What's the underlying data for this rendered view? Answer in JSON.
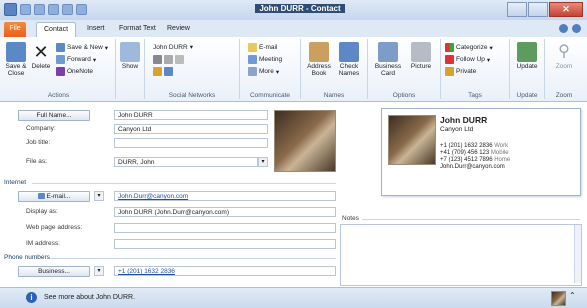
{
  "window": {
    "title_name": "John DURR",
    "title_suffix": "- Contact"
  },
  "tabs": [
    "File",
    "Contact",
    "Insert",
    "Format Text",
    "Review"
  ],
  "ribbon": {
    "actions": {
      "save_close": "Save & Close",
      "delete": "Delete",
      "save_new": "Save & New",
      "forward": "Forward",
      "onenote": "OneNote",
      "label": "Actions"
    },
    "show": {
      "label": "Show"
    },
    "social": {
      "contact": "John DURR",
      "label": "Social Networks"
    },
    "communicate": {
      "email": "E-mail",
      "meeting": "Meeting",
      "more": "More",
      "label": "Communicate"
    },
    "names": {
      "address_book": "Address Book",
      "check_names": "Check Names",
      "label": "Names"
    },
    "options": {
      "business_card": "Business Card",
      "picture": "Picture",
      "label": "Options"
    },
    "tags": {
      "categorize": "Categorize",
      "follow_up": "Follow Up",
      "private": "Private",
      "label": "Tags"
    },
    "update": {
      "update": "Update",
      "label": "Update"
    },
    "zoom": {
      "zoom": "Zoom",
      "label": "Zoom"
    }
  },
  "form": {
    "full_name_btn": "Full Name...",
    "full_name": "John DURR",
    "company_label": "Company:",
    "company": "Canyon Ltd",
    "job_title_label": "Job title:",
    "job_title": "",
    "file_as_label": "File as:",
    "file_as": "DURR, John",
    "internet_label": "Internet",
    "email_btn": "E-mail...",
    "email": "John.Durr@canyon.com",
    "display_as_label": "Display as:",
    "display_as": "John DURR (John.Durr@canyon.com)",
    "web_label": "Web page address:",
    "web": "",
    "im_label": "IM address:",
    "im": "",
    "phone_label": "Phone numbers",
    "business_btn": "Business...",
    "business_phone": "+1 (201) 1632 2836",
    "notes_label": "Notes"
  },
  "card": {
    "name": "John DURR",
    "company": "Canyon Ltd",
    "phones": [
      {
        "number": "+1 (201) 1632 2836",
        "type": "Work"
      },
      {
        "number": "+41 (709) 456 123",
        "type": "Mobile"
      },
      {
        "number": "+7 (123) 4512 7896",
        "type": "Home"
      }
    ],
    "email": "John.Durr@canyon.com"
  },
  "status": {
    "text": "See more about John DURR."
  },
  "colors": {
    "file_tab": "#e3641a",
    "accent": "#2a62b6",
    "link": "#1f4fa3"
  }
}
